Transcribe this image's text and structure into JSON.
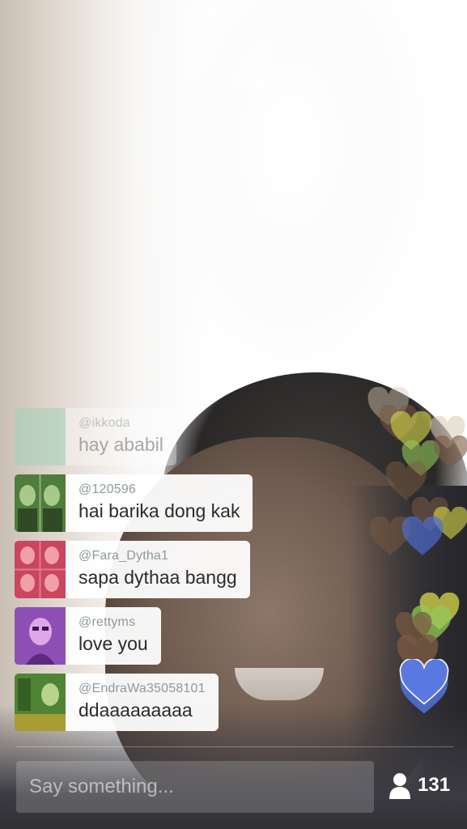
{
  "stream": {
    "viewer_count": "131"
  },
  "comments": [
    {
      "handle": "@ikkoda",
      "message": "hay ababil",
      "faded": true
    },
    {
      "handle": "@120596",
      "message": "hai barika dong kak"
    },
    {
      "handle": "@Fara_Dytha1",
      "message": "sapa dythaa bangg"
    },
    {
      "handle": "@rettyms",
      "message": "love you"
    },
    {
      "handle": "@EndraWa35058101",
      "message": "ddaaaaaaaaa"
    }
  ],
  "input": {
    "placeholder": "Say something..."
  },
  "icons": {
    "close": "close-icon",
    "viewers": "person-icon",
    "hearts": "heart-icon"
  },
  "colors": {
    "heart_blue": "#4f6fd6",
    "heart_green": "#93c85a",
    "heart_yellow": "#d8d84a",
    "heart_brown": "#7a5a42",
    "heart_beige": "#d8c9b4"
  }
}
